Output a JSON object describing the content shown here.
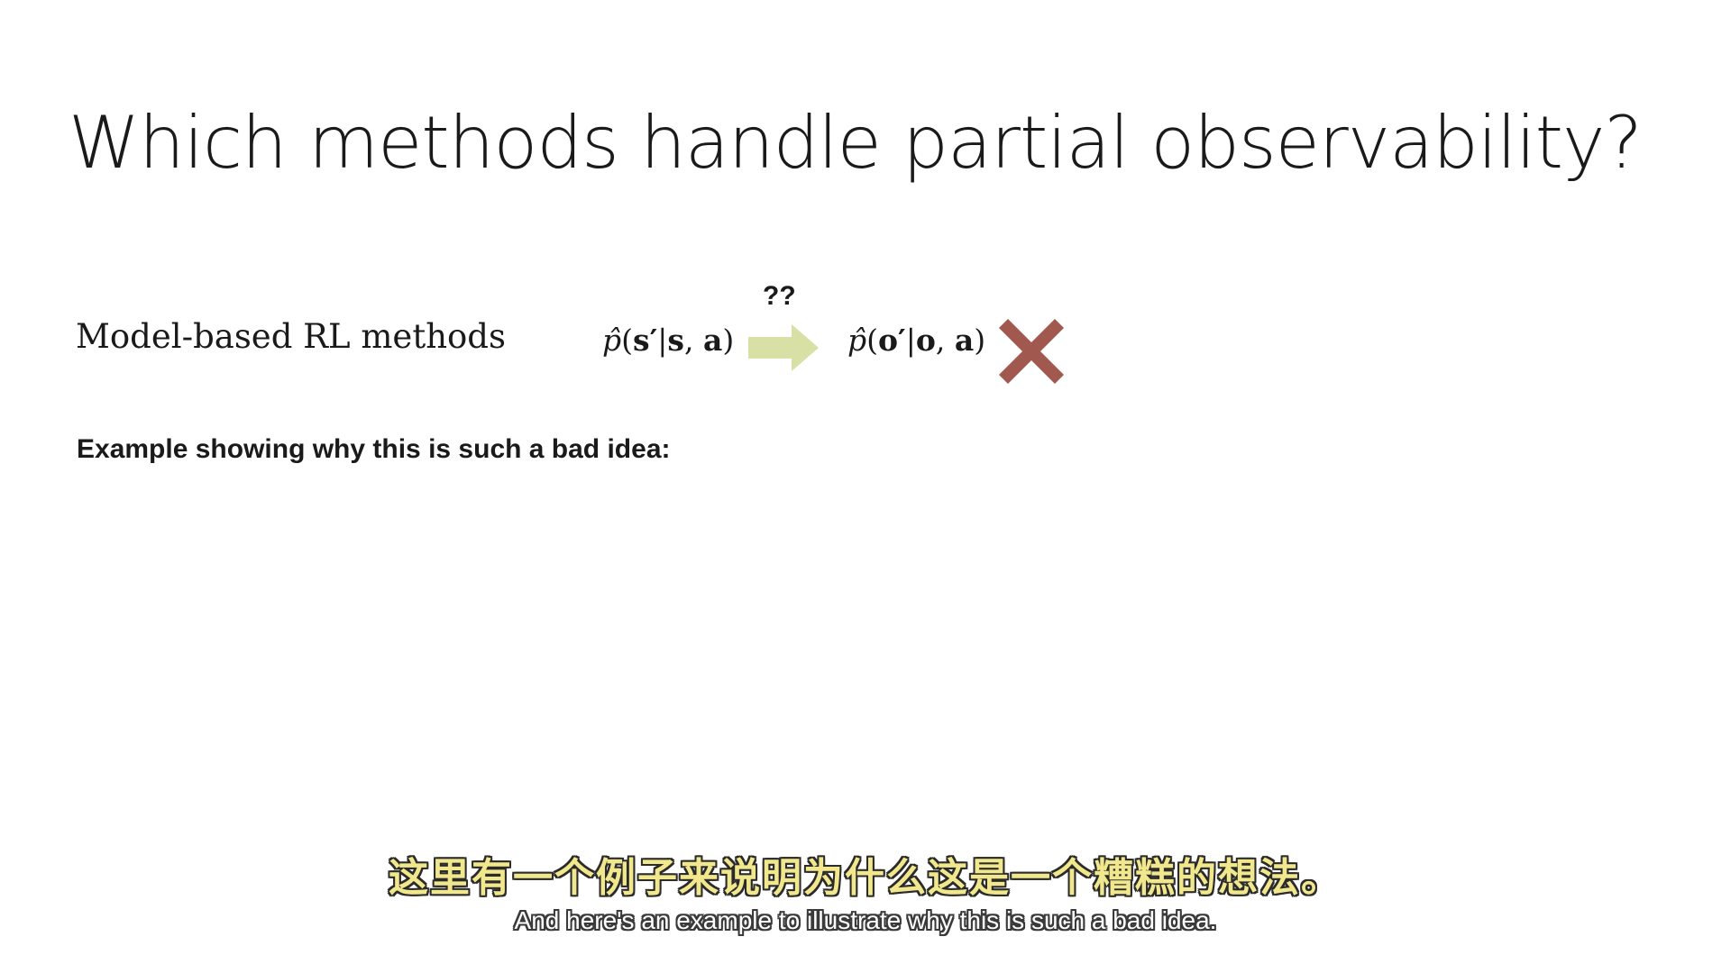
{
  "slide": {
    "title": "Which methods handle partial observability?",
    "method_label": "Model-based RL methods",
    "formula_left": {
      "p": "p̂",
      "open": "(",
      "state_next": "s′",
      "bar": "|",
      "state": "s",
      "comma": ", ",
      "action": "a",
      "close": ")"
    },
    "arrow_label": "??",
    "formula_right": {
      "p": "p̂",
      "open": "(",
      "obs_next": "o′",
      "bar": "|",
      "obs": "o",
      "comma": ", ",
      "action": "a",
      "close": ")"
    },
    "example_heading": "Example showing why this is such a bad idea:",
    "colors": {
      "arrow": "#d9e0a6",
      "x_mark": "#a0584f",
      "subtitle_cn": "#f1e78c",
      "subtitle_outline": "#2b2b2b"
    },
    "icons": {
      "arrow": "right-arrow-icon",
      "x_mark": "cross-mark-icon"
    }
  },
  "subtitles": {
    "chinese": "这里有一个例子来说明为什么这是一个糟糕的想法。",
    "english": "And here's an example to illustrate why this is such a bad idea."
  }
}
